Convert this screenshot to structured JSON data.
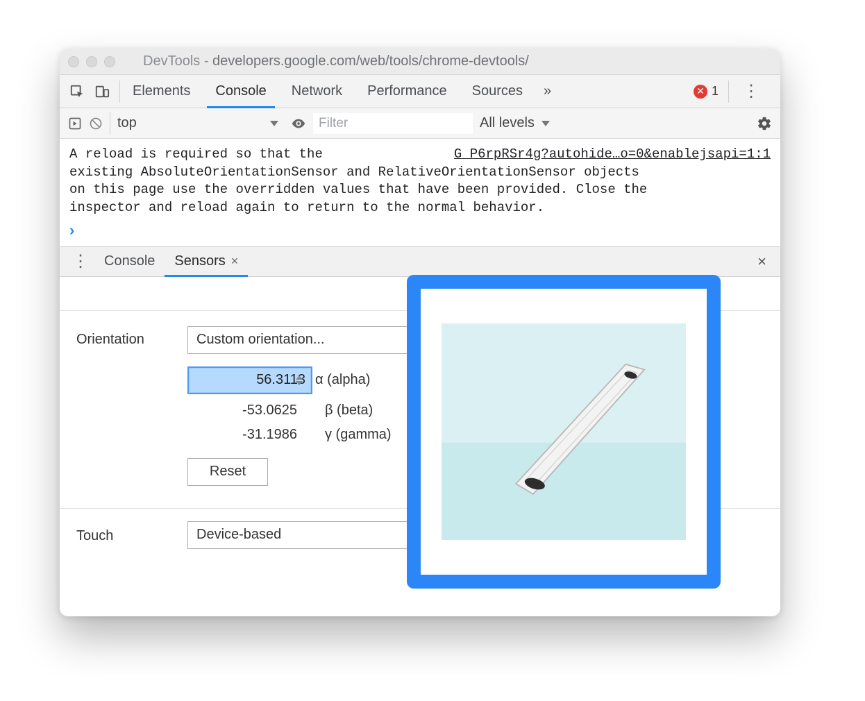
{
  "window": {
    "title_prefix": "DevTools - ",
    "title_url": "developers.google.com/web/tools/chrome-devtools/"
  },
  "tabs": {
    "items": [
      "Elements",
      "Console",
      "Network",
      "Performance",
      "Sources"
    ],
    "active_index": 1,
    "overflow_glyph": "»",
    "error_count": "1"
  },
  "consolebar": {
    "context": "top",
    "filter_placeholder": "Filter",
    "levels_label": "All levels"
  },
  "console": {
    "link_text": "G P6rpRSr4g?autohide…o=0&enablejsapi=1:1",
    "msg_line1a": "A reload is required so that the ",
    "msg_line2": "existing AbsoluteOrientationSensor and RelativeOrientationSensor objects",
    "msg_line3": "on this page use the overridden values that have been provided. Close the",
    "msg_line4": "inspector and reload again to return to the normal behavior."
  },
  "drawer": {
    "tabs": [
      "Console",
      "Sensors"
    ],
    "active_index": 1
  },
  "sensors": {
    "orientation": {
      "label": "Orientation",
      "select_value": "Custom orientation...",
      "alpha_value": "56.3113",
      "alpha_label": "α (alpha)",
      "beta_value": "-53.0625",
      "beta_label": "β (beta)",
      "gamma_value": "-31.1986",
      "gamma_label": "γ (gamma)",
      "reset_label": "Reset"
    },
    "touch": {
      "label": "Touch",
      "select_value": "Device-based"
    }
  }
}
